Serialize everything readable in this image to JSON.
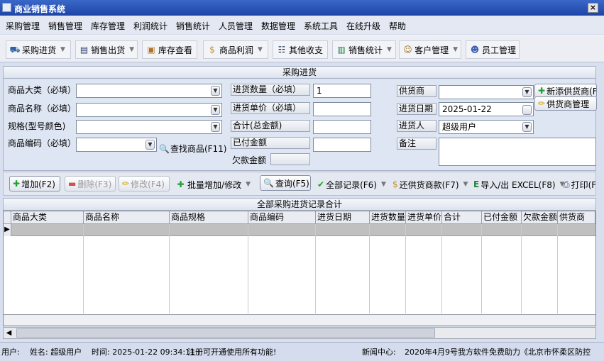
{
  "window": {
    "title": "商业销售系统",
    "close_label": "×"
  },
  "menu": [
    "采购管理",
    "销售管理",
    "库存管理",
    "利润统计",
    "销售统计",
    "人员管理",
    "数据管理",
    "系统工具",
    "在线升级",
    "帮助"
  ],
  "toolbar": [
    {
      "label": "采购进货",
      "icon": "cart-icon"
    },
    {
      "label": "销售出货",
      "icon": "document-icon"
    },
    {
      "label": "库存查看",
      "icon": "box-icon"
    },
    {
      "label": "商品利润",
      "icon": "money-bag-icon"
    },
    {
      "label": "其他收支",
      "icon": "ledger-icon"
    },
    {
      "label": "销售统计",
      "icon": "bar-chart-icon"
    },
    {
      "label": "客户管理",
      "icon": "customers-icon"
    },
    {
      "label": "员工管理",
      "icon": "staff-icon"
    }
  ],
  "form": {
    "section_title": "采购进货",
    "category_label": "商品大类（必填）",
    "category_value": "",
    "name_label": "商品名称（必填）",
    "name_value": "",
    "spec_label": "规格(型号颜色)",
    "spec_value": "",
    "code_label": "商品编码（必填）",
    "code_value": "",
    "find_product_label": "查找商品(F11)",
    "qty_label": "进货数量（必填）",
    "qty_value": "1",
    "unit_price_label": "进货单价（必填）",
    "unit_price_value": "",
    "total_label": "合计(总金额)",
    "total_value": "",
    "paid_label": "已付金额",
    "paid_value": "",
    "owed_label": "欠款金额",
    "owed_value": "",
    "supplier_label": "供货商",
    "supplier_value": "",
    "date_label": "进货日期",
    "date_value": "2025-01-22",
    "buyer_label": "进货人",
    "buyer_value": "超级用户",
    "note_label": "备注",
    "note_value": "",
    "add_supplier_label": "新添供货商(F",
    "manage_supplier_label": "供货商管理"
  },
  "actions": {
    "add": "增加(F2)",
    "delete": "删除(F3)",
    "edit": "修改(F4)",
    "batch": "批量增加/修改",
    "query": "查询(F5)",
    "all_records": "全部记录(F6)",
    "repay": "还供货商款(F7)",
    "excel": "导入/出 EXCEL(F8)",
    "print": "打印(F"
  },
  "grid": {
    "title": "全部采购进货记录合计",
    "columns": [
      "商品大类",
      "商品名称",
      "商品规格",
      "商品编码",
      "进货日期",
      "进货数量",
      "进货单价",
      "合计",
      "已付金额",
      "欠款金额",
      "供货商"
    ]
  },
  "status": {
    "user_prefix": "用户:",
    "name_text": "姓名: 超级用户",
    "time_text": "时间: 2025-01-22 09:34:11",
    "notice": "注册可开通使用所有功能!",
    "news_prefix": "新闻中心:",
    "news_text": "2020年4月9号我方软件免费助力《北京市怀柔区防控"
  },
  "colors": {
    "titlebar": "#1d45a8",
    "form_bg": "#dfe6f3",
    "selected_row": "#c0c0c0"
  }
}
